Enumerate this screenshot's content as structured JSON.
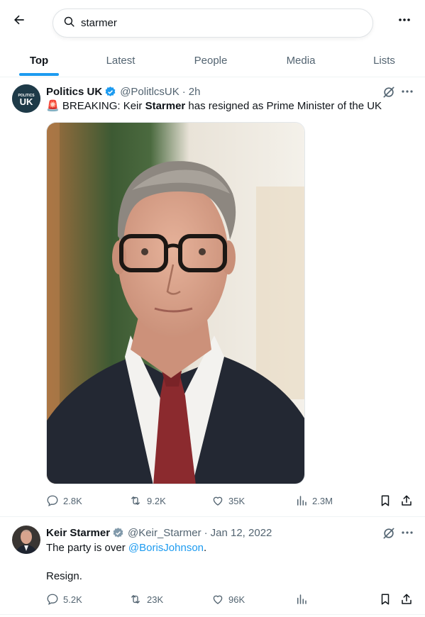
{
  "search": {
    "query": "starmer"
  },
  "tabs": [
    {
      "label": "Top",
      "active": true
    },
    {
      "label": "Latest",
      "active": false
    },
    {
      "label": "People",
      "active": false
    },
    {
      "label": "Media",
      "active": false
    },
    {
      "label": "Lists",
      "active": false
    }
  ],
  "tweets": [
    {
      "avatar_text_top": "POLITICS",
      "avatar_text_main": "UK",
      "name": "Politics UK",
      "verified": "blue",
      "handle": "@PolitlcsUK",
      "time": "2h",
      "text_emoji": "🚨",
      "text_before": " BREAKING: Keir ",
      "text_bold": "Starmer",
      "text_after": " has resigned as Prime Minister of the UK",
      "stats": {
        "replies": "2.8K",
        "reposts": "9.2K",
        "likes": "35K",
        "views": "2.3M"
      }
    },
    {
      "name": "Keir Starmer",
      "verified": "grey",
      "handle": "@Keir_Starmer",
      "time": "Jan 12, 2022",
      "text_line1_before": "The party is over ",
      "mention": "@BorisJohnson",
      "text_line1_after": ".",
      "text_line2": "Resign.",
      "stats": {
        "replies": "5.2K",
        "reposts": "23K",
        "likes": "96K",
        "views": ""
      }
    }
  ],
  "colors": {
    "accent": "#1d9bf0",
    "muted": "#536471",
    "verified_grey": "#829aab"
  },
  "icons": [
    "back-arrow-icon",
    "search-icon",
    "more-icon",
    "verified-icon",
    "grok-icon",
    "reply-icon",
    "repost-icon",
    "like-icon",
    "views-icon",
    "bookmark-icon",
    "share-icon"
  ]
}
